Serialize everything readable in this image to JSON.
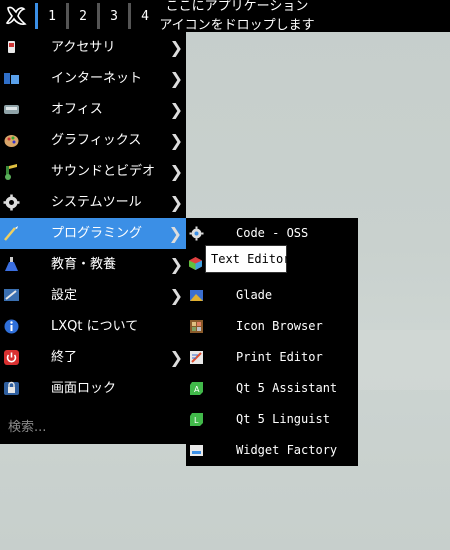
{
  "panel": {
    "desktops": [
      "1",
      "2",
      "3",
      "4"
    ],
    "drop_hint_line1": "ここにアプリケーション",
    "drop_hint_line2": "アイコンをドロップします"
  },
  "menu": {
    "items": [
      {
        "label": "アクセサリ",
        "icon": "accessories-icon",
        "has_submenu": true
      },
      {
        "label": "インターネット",
        "icon": "internet-icon",
        "has_submenu": true
      },
      {
        "label": "オフィス",
        "icon": "office-icon",
        "has_submenu": true
      },
      {
        "label": "グラフィックス",
        "icon": "graphics-icon",
        "has_submenu": true
      },
      {
        "label": "サウンドとビデオ",
        "icon": "sound-video-icon",
        "has_submenu": true
      },
      {
        "label": "システムツール",
        "icon": "system-tools-icon",
        "has_submenu": true
      },
      {
        "label": "プログラミング",
        "icon": "programming-icon",
        "has_submenu": true,
        "highlighted": true
      },
      {
        "label": "教育・教養",
        "icon": "education-icon",
        "has_submenu": true
      },
      {
        "label": "設定",
        "icon": "settings-icon",
        "has_submenu": true
      },
      {
        "label": "LXQt について",
        "icon": "about-icon",
        "has_submenu": false
      },
      {
        "label": "終了",
        "icon": "power-icon",
        "has_submenu": true
      },
      {
        "label": "画面ロック",
        "icon": "lock-screen-icon",
        "has_submenu": false
      }
    ],
    "search_placeholder": "検索..."
  },
  "submenu": {
    "items": [
      {
        "label": "Code - OSS",
        "icon": "code-oss-icon"
      },
      {
        "label": "Glade",
        "icon": "glade-icon"
      },
      {
        "label": "Icon Browser",
        "icon": "icon-browser-icon"
      },
      {
        "label": "Print Editor",
        "icon": "print-editor-icon"
      },
      {
        "label": "Qt 5 Assistant",
        "icon": "qt-assistant-icon"
      },
      {
        "label": "Qt 5 Linguist",
        "icon": "qt-linguist-icon"
      },
      {
        "label": "Widget Factory",
        "icon": "widget-factory-icon"
      }
    ]
  },
  "tooltip": {
    "text": "Text Editor"
  },
  "colors": {
    "highlight": "#3b8fe6",
    "menu_bg": "#000000",
    "desktop": "#c8d0cc"
  }
}
